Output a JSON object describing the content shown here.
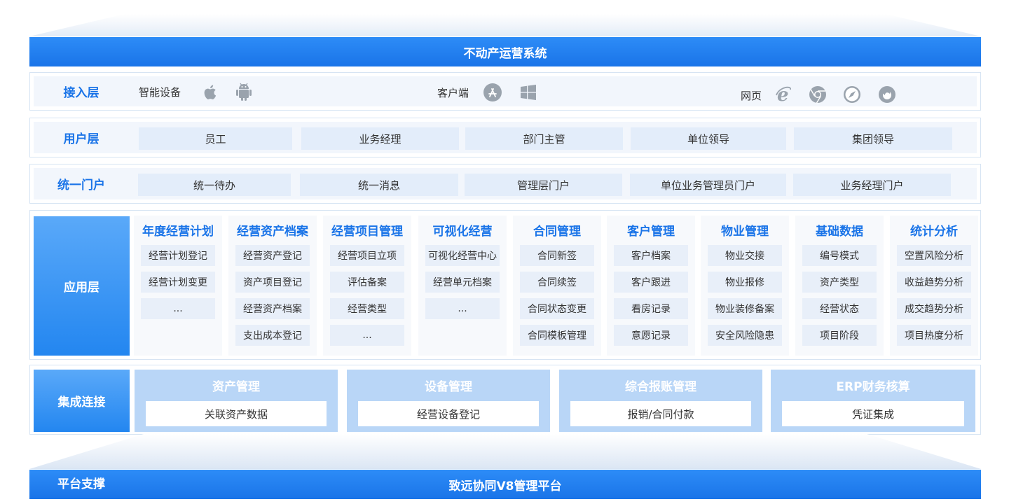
{
  "top_banner": "不动产运营系统",
  "access": {
    "label": "接入层",
    "smart_device": "智能设备",
    "client": "客户端",
    "web": "网页"
  },
  "user_layer": {
    "label": "用户层",
    "items": [
      "员工",
      "业务经理",
      "部门主管",
      "单位领导",
      "集团领导"
    ]
  },
  "portal": {
    "label": "统一门户",
    "items": [
      "统一待办",
      "统一消息",
      "管理层门户",
      "单位业务管理员门户",
      "业务经理门户"
    ]
  },
  "app_layer": {
    "label": "应用层",
    "columns": [
      {
        "title": "年度经营计划",
        "items": [
          "经营计划登记",
          "经营计划变更",
          "..."
        ]
      },
      {
        "title": "经营资产档案",
        "items": [
          "经营资产登记",
          "资产项目登记",
          "经营资产档案",
          "支出成本登记"
        ]
      },
      {
        "title": "经营项目管理",
        "items": [
          "经营项目立项",
          "评估备案",
          "经营类型",
          "..."
        ]
      },
      {
        "title": "可视化经营",
        "items": [
          "可视化经营中心",
          "经营单元档案",
          "..."
        ]
      },
      {
        "title": "合同管理",
        "items": [
          "合同新签",
          "合同续签",
          "合同状态变更",
          "合同模板管理"
        ]
      },
      {
        "title": "客户管理",
        "items": [
          "客户档案",
          "客户跟进",
          "看房记录",
          "意愿记录"
        ]
      },
      {
        "title": "物业管理",
        "items": [
          "物业交接",
          "物业报修",
          "物业装修备案",
          "安全风险隐患"
        ]
      },
      {
        "title": "基础数据",
        "items": [
          "编号模式",
          "资产类型",
          "经营状态",
          "项目阶段"
        ]
      },
      {
        "title": "统计分析",
        "items": [
          "空置风险分析",
          "收益趋势分析",
          "成交趋势分析",
          "项目热度分析"
        ]
      }
    ]
  },
  "integration": {
    "label": "集成连接",
    "blocks": [
      {
        "title": "资产管理",
        "item": "关联资产数据"
      },
      {
        "title": "设备管理",
        "item": "经营设备登记"
      },
      {
        "title": "综合报账管理",
        "item": "报销/合同付款"
      },
      {
        "title": "ERP财务核算",
        "item": "凭证集成"
      }
    ]
  },
  "platform": {
    "label": "平台支撑",
    "title": "致远协同V8管理平台"
  },
  "icons": [
    "apple-icon",
    "android-icon",
    "app-store-icon",
    "windows-icon",
    "ie-icon",
    "chrome-icon",
    "safari-icon",
    "firefox-icon"
  ],
  "colors": {
    "primary": "#1a74e8",
    "light": "#e3edfa",
    "integration": "#b9d6f7"
  }
}
